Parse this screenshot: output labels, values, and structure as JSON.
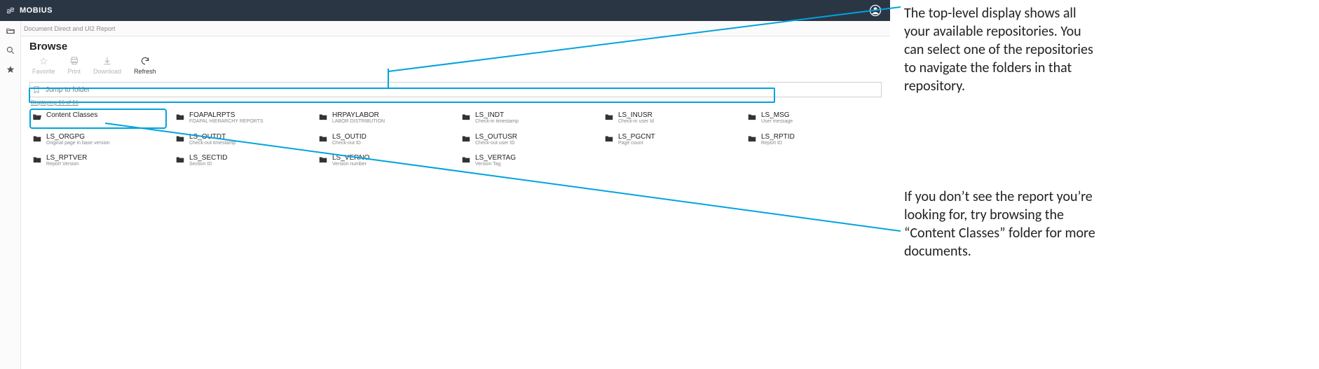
{
  "brand": "MOBIUS",
  "breadcrumb": "Document Direct and UI2 Report",
  "page_title": "Browse",
  "toolbar": {
    "favorite": "Favorite",
    "print": "Print",
    "download": "Download",
    "refresh": "Refresh"
  },
  "search": {
    "placeholder": "Jump to folder"
  },
  "displaying": "Displaying 16 of 16",
  "folders": [
    {
      "name": "Content Classes",
      "desc": "",
      "highlight": true
    },
    {
      "name": "FOAPALRPTS",
      "desc": "FOAPAL HIERARCHY REPORTS"
    },
    {
      "name": "HRPAYLABOR",
      "desc": "LABOR DISTRIBUTION"
    },
    {
      "name": "LS_INDT",
      "desc": "Check-in timestamp"
    },
    {
      "name": "LS_INUSR",
      "desc": "Check-in user Id"
    },
    {
      "name": "LS_MSG",
      "desc": "User message"
    },
    {
      "name": "LS_ORGPG",
      "desc": "Original page in base version"
    },
    {
      "name": "LS_OUTDT",
      "desc": "Check-out timestamp"
    },
    {
      "name": "LS_OUTID",
      "desc": "Check-out ID"
    },
    {
      "name": "LS_OUTUSR",
      "desc": "Check-out user ID"
    },
    {
      "name": "LS_PGCNT",
      "desc": "Page count"
    },
    {
      "name": "LS_RPTID",
      "desc": "Report ID"
    },
    {
      "name": "LS_RPTVER",
      "desc": "Report Version"
    },
    {
      "name": "LS_SECTID",
      "desc": "Section ID"
    },
    {
      "name": "LS_VERNO",
      "desc": "Version number"
    },
    {
      "name": "LS_VERTAG",
      "desc": "Version Tag"
    }
  ],
  "annotations": {
    "top": "The top-level display shows all your available repositories. You can select one of the repositories to navigate the folders in that repository.",
    "bottom": "If you don’t see the report you’re looking for, try browsing the “Content Classes” folder for more documents."
  }
}
